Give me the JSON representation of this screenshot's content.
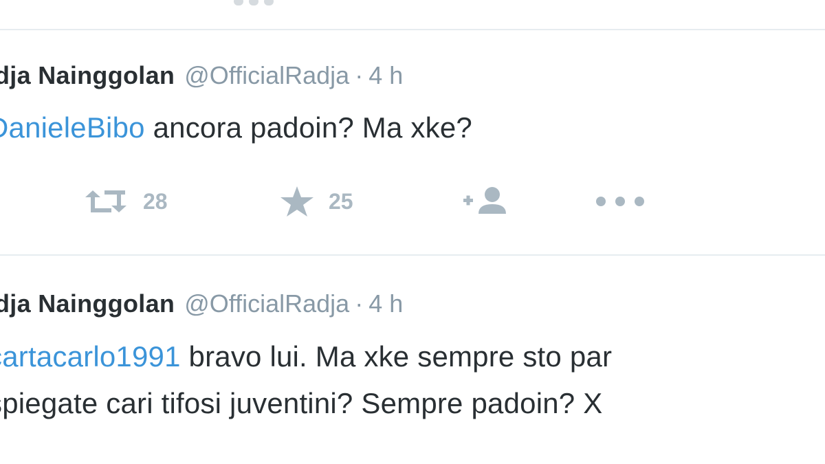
{
  "tweets": [
    {
      "name": "dja Nainggolan",
      "handle": "@OfficialRadja",
      "separator": "·",
      "time": "4 h",
      "mention": "DanieleBibo",
      "text_rest": " ancora padoin? Ma xke?",
      "line2": "",
      "retweets": "28",
      "favorites": "25"
    },
    {
      "name": "dja Nainggolan",
      "handle": "@OfficialRadja",
      "separator": "·",
      "time": "4 h",
      "mention": "cartacarlo1991",
      "text_rest": " bravo lui. Ma xke sempre sto par",
      "line2": "spiegate cari tifosi juventini? Sempre padoin? X"
    }
  ],
  "icons": {
    "retweet": "retweet-icon",
    "favorite": "star-icon",
    "follow": "follow-plus-person-icon",
    "more": "more-dots-icon"
  },
  "colors": {
    "name": "#292f33",
    "muted": "#8899a6",
    "link": "#3b94d9",
    "action_icon": "#aab8c2",
    "divider": "#e6ecf0"
  }
}
